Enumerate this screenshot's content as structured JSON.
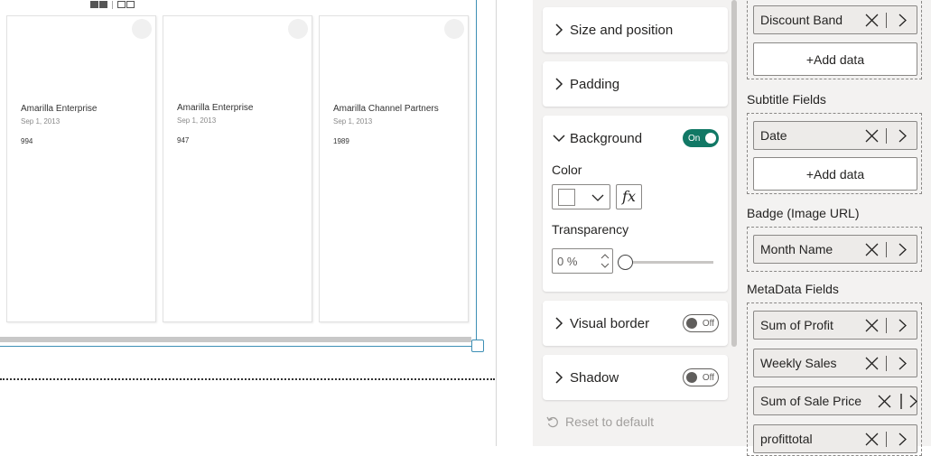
{
  "cards": [
    {
      "title": "Amarilla Enterprise",
      "subtitle": "Sep 1, 2013",
      "meta": "994"
    },
    {
      "title": "Amarilla Enterprise",
      "subtitle": "Sep 1, 2013",
      "meta": "947"
    },
    {
      "title": "Amarilla Channel Partners",
      "subtitle": "Sep 1, 2013",
      "meta": "1989"
    }
  ],
  "format": {
    "size_position": "Size and position",
    "padding": "Padding",
    "background": {
      "label": "Background",
      "toggle": "On",
      "color_label": "Color",
      "transparency_label": "Transparency",
      "transparency_value": "0 %",
      "color": "#ffffff"
    },
    "visual_border": {
      "label": "Visual border",
      "toggle": "Off"
    },
    "shadow": {
      "label": "Shadow",
      "toggle": "Off"
    },
    "reset": "Reset to default"
  },
  "fields": {
    "title_fields": {
      "items": [
        "Discount Band"
      ],
      "add": "+Add data"
    },
    "subtitle_fields": {
      "label": "Subtitle Fields",
      "items": [
        "Date"
      ],
      "add": "+Add data"
    },
    "badge": {
      "label": "Badge (Image URL)",
      "items": [
        "Month Name"
      ]
    },
    "metadata": {
      "label": "MetaData Fields",
      "items": [
        "Sum of Profit",
        "Weekly Sales",
        "Sum of Sale Price",
        "profittotal"
      ]
    }
  },
  "colors": {
    "accent": "#117865",
    "frame": "#3d8fb5"
  }
}
